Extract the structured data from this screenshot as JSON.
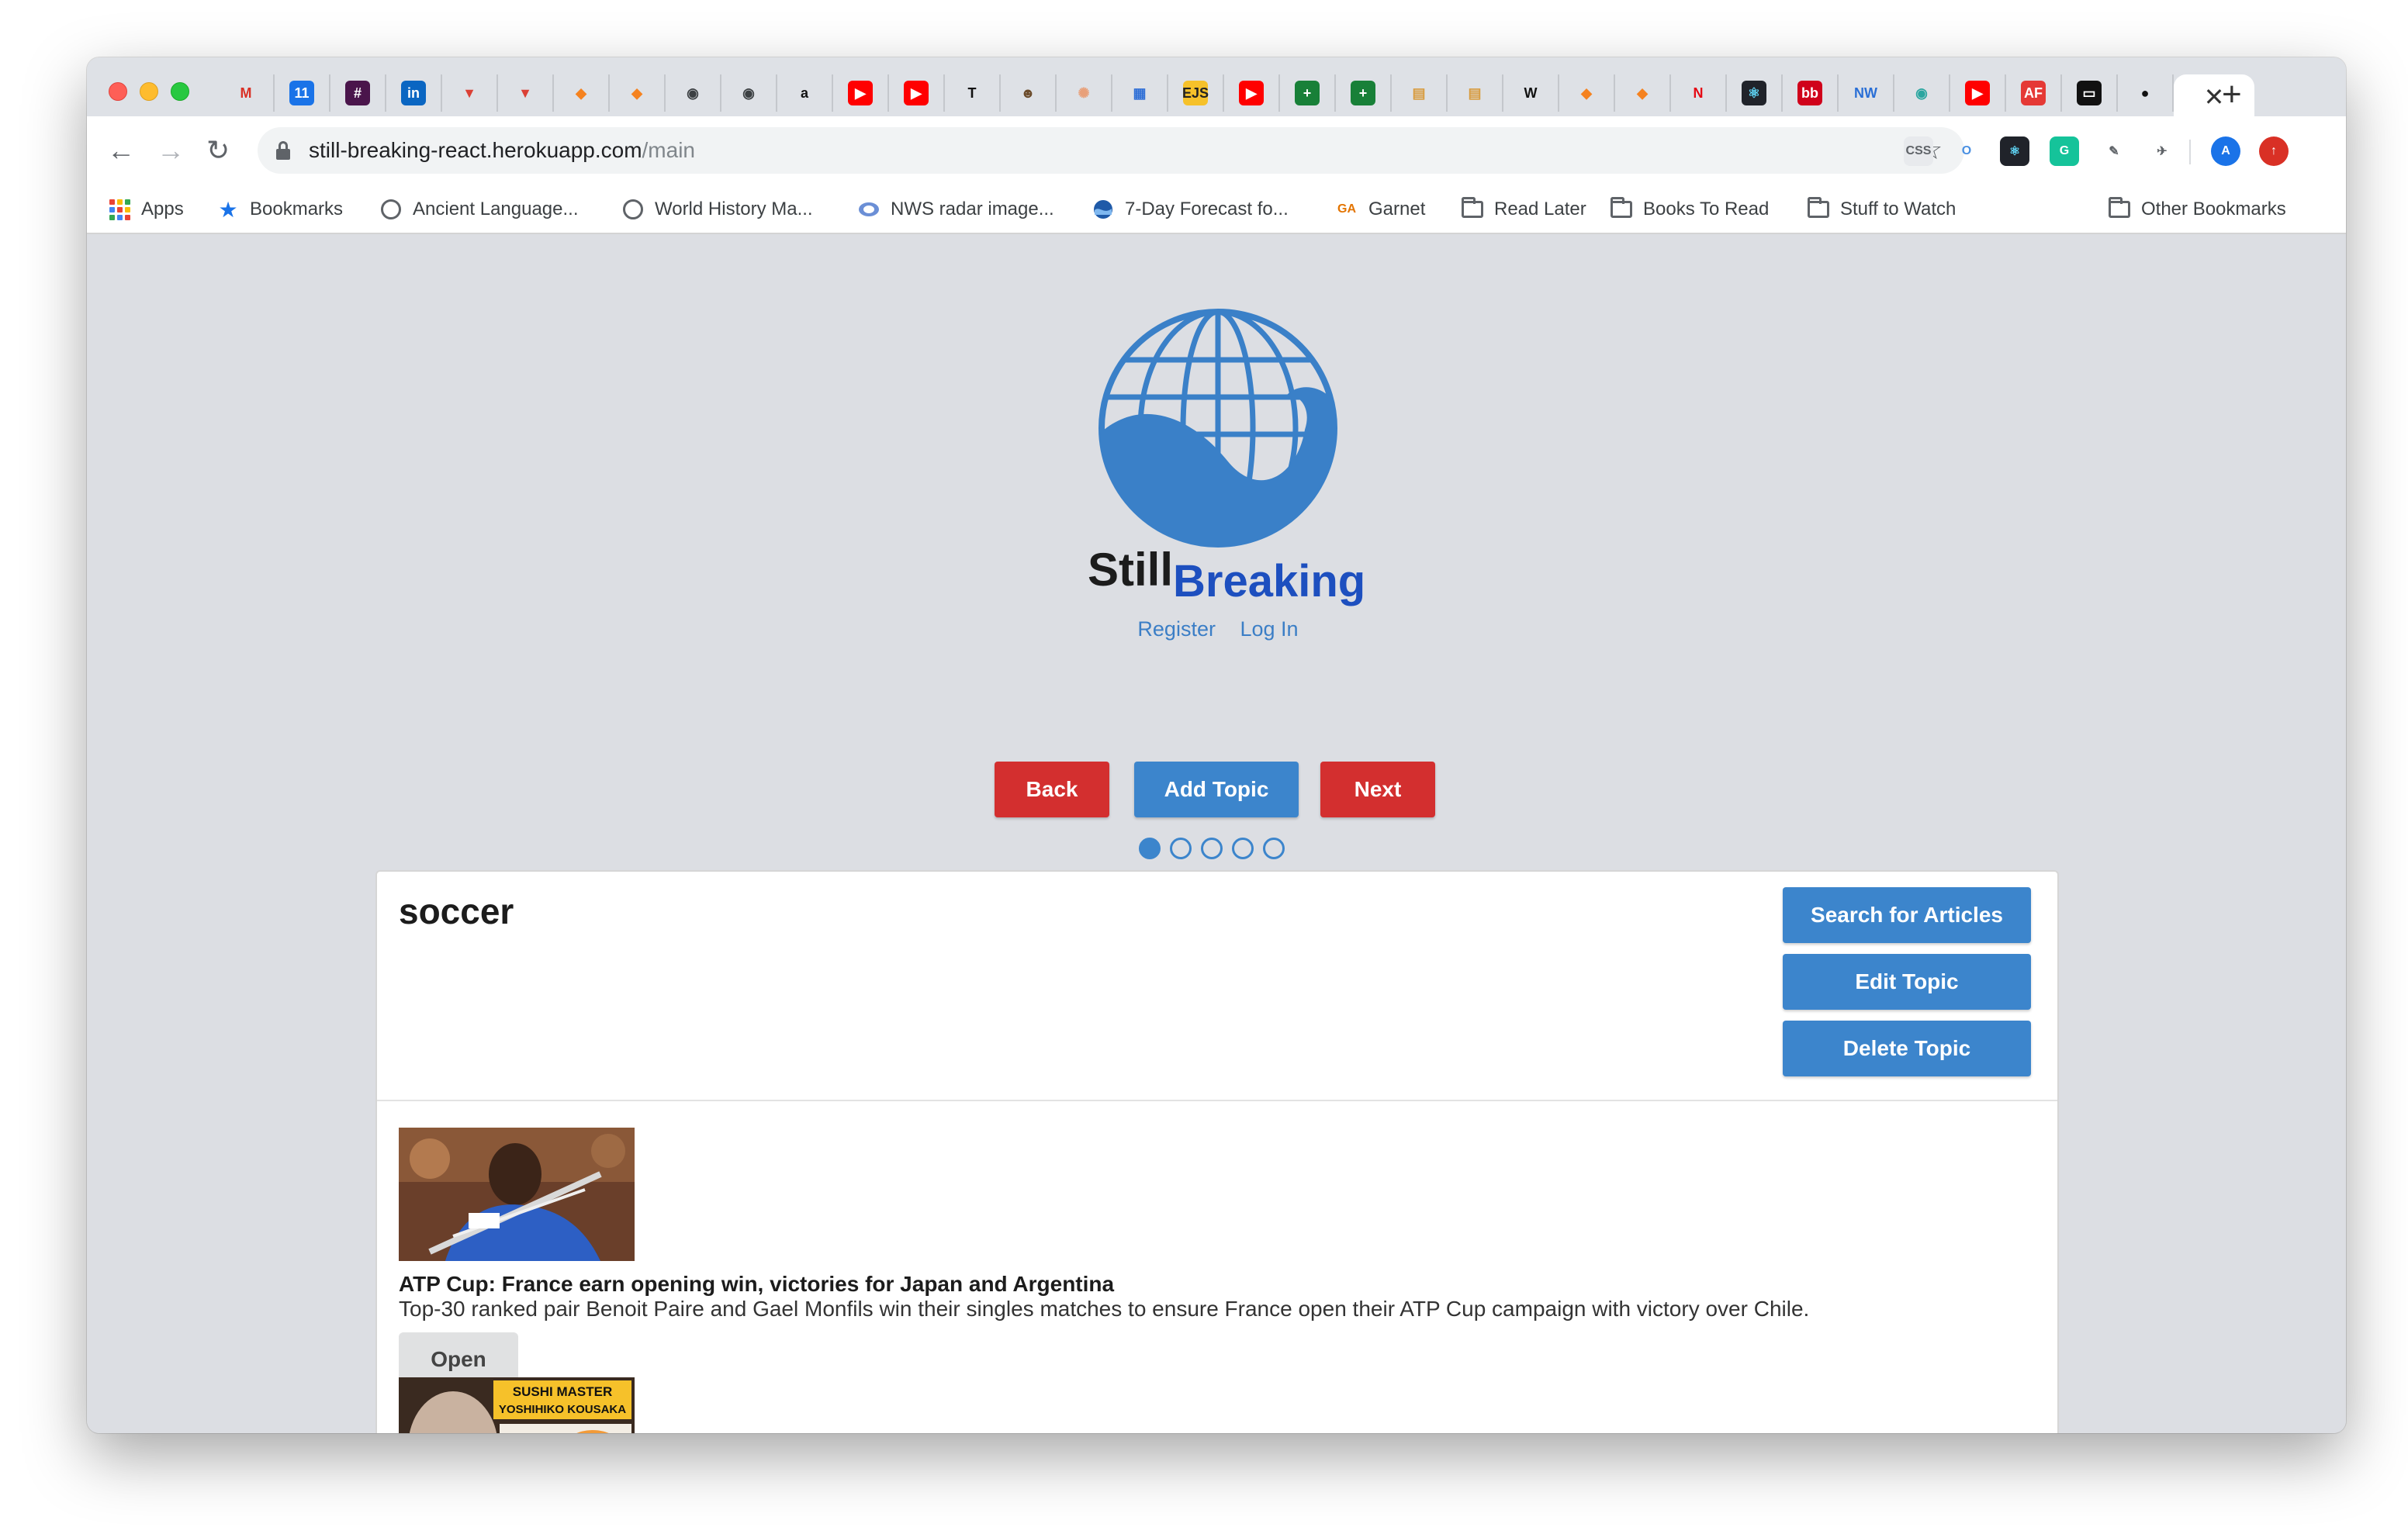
{
  "browser": {
    "active_tab_close": "✕",
    "new_tab": "+",
    "url_host": "still-breaking-react.herokuapp.com",
    "url_path": "/main",
    "tab_favicons": [
      {
        "icon": "gmail-icon",
        "glyph": "M",
        "color": "#d93025",
        "bg": "transparent"
      },
      {
        "icon": "calendar-icon",
        "glyph": "11",
        "color": "#ffffff",
        "bg": "#1a73e8"
      },
      {
        "icon": "slack-icon",
        "glyph": "#",
        "color": "#ffffff",
        "bg": "#4a154b"
      },
      {
        "icon": "linkedin-icon",
        "glyph": "in",
        "color": "#ffffff",
        "bg": "#0a66c2"
      },
      {
        "icon": "todoist-icon",
        "glyph": "▼",
        "color": "#db4035",
        "bg": "transparent"
      },
      {
        "icon": "todoist-icon",
        "glyph": "▼",
        "color": "#db4035",
        "bg": "transparent"
      },
      {
        "icon": "box-icon",
        "glyph": "◆",
        "color": "#f5821f",
        "bg": "transparent"
      },
      {
        "icon": "box-icon",
        "glyph": "◆",
        "color": "#f5821f",
        "bg": "transparent"
      },
      {
        "icon": "globe-icon",
        "glyph": "◉",
        "color": "#3c4043",
        "bg": "transparent"
      },
      {
        "icon": "globe-icon",
        "glyph": "◉",
        "color": "#3c4043",
        "bg": "transparent"
      },
      {
        "icon": "amazon-icon",
        "glyph": "a",
        "color": "#111111",
        "bg": "transparent"
      },
      {
        "icon": "youtube-icon",
        "glyph": "▶",
        "color": "#ffffff",
        "bg": "#ff0000"
      },
      {
        "icon": "youtube-icon",
        "glyph": "▶",
        "color": "#ffffff",
        "bg": "#ff0000"
      },
      {
        "icon": "nytimes-icon",
        "glyph": "T",
        "color": "#111111",
        "bg": "transparent"
      },
      {
        "icon": "meerkat-icon",
        "glyph": "☻",
        "color": "#6b4b2a",
        "bg": "transparent"
      },
      {
        "icon": "sparkle-icon",
        "glyph": "✺",
        "color": "#e8a07a",
        "bg": "transparent"
      },
      {
        "icon": "dashboard-icon",
        "glyph": "▦",
        "color": "#2f6fd6",
        "bg": "transparent"
      },
      {
        "icon": "ejs-icon",
        "glyph": "EJS",
        "color": "#222222",
        "bg": "#f6c12a"
      },
      {
        "icon": "youtube-icon",
        "glyph": "▶",
        "color": "#ffffff",
        "bg": "#ff0000"
      },
      {
        "icon": "sheets-icon",
        "glyph": "+",
        "color": "#ffffff",
        "bg": "#188038"
      },
      {
        "icon": "sheets-icon",
        "glyph": "+",
        "color": "#ffffff",
        "bg": "#188038"
      },
      {
        "icon": "book-icon",
        "glyph": "▤",
        "color": "#d89b3d",
        "bg": "transparent"
      },
      {
        "icon": "book-icon",
        "glyph": "▤",
        "color": "#d89b3d",
        "bg": "transparent"
      },
      {
        "icon": "wikipedia-icon",
        "glyph": "W",
        "color": "#111111",
        "bg": "transparent"
      },
      {
        "icon": "box-icon",
        "glyph": "◆",
        "color": "#f5821f",
        "bg": "transparent"
      },
      {
        "icon": "box-icon",
        "glyph": "◆",
        "color": "#f5821f",
        "bg": "transparent"
      },
      {
        "icon": "netflix-icon",
        "glyph": "N",
        "color": "#e50914",
        "bg": "transparent"
      },
      {
        "icon": "react-icon",
        "glyph": "⚛",
        "color": "#61dafb",
        "bg": "#20232a"
      },
      {
        "icon": "bb-icon",
        "glyph": "bb",
        "color": "#ffffff",
        "bg": "#d0021b"
      },
      {
        "icon": "nw-icon",
        "glyph": "NW",
        "color": "#2a6fd6",
        "bg": "transparent"
      },
      {
        "icon": "eye-icon",
        "glyph": "◉",
        "color": "#2aa6a0",
        "bg": "transparent"
      },
      {
        "icon": "youtube-icon",
        "glyph": "▶",
        "color": "#ffffff",
        "bg": "#ff0000"
      },
      {
        "icon": "af-icon",
        "glyph": "AF",
        "color": "#ffffff",
        "bg": "#e53935"
      },
      {
        "icon": "terminal-icon",
        "glyph": "▭",
        "color": "#ffffff",
        "bg": "#111111"
      },
      {
        "icon": "github-icon",
        "glyph": "●",
        "color": "#111111",
        "bg": "transparent"
      }
    ],
    "extensions": [
      {
        "icon": "css-icon",
        "glyph": "CSS",
        "color": "#5f6368",
        "bg": "#e8eaed"
      },
      {
        "icon": "opera-icon",
        "glyph": "O",
        "color": "#4a90e2",
        "bg": "transparent"
      },
      {
        "icon": "react-devtools-icon",
        "glyph": "⚛",
        "color": "#61dafb",
        "bg": "#20232a"
      },
      {
        "icon": "grammarly-icon",
        "glyph": "G",
        "color": "#ffffff",
        "bg": "#15c39a"
      },
      {
        "icon": "eyedropper-icon",
        "glyph": "✎",
        "color": "#5f6368",
        "bg": "transparent"
      },
      {
        "icon": "octotree-icon",
        "glyph": "✈",
        "color": "#5f6368",
        "bg": "transparent"
      },
      {
        "icon": "profile-avatar-icon",
        "glyph": "A",
        "color": "#ffffff",
        "bg": "#1a73e8"
      },
      {
        "icon": "update-icon",
        "glyph": "↑",
        "color": "#ffffff",
        "bg": "#d93025"
      }
    ],
    "extension_badge": "2"
  },
  "bookmarks": [
    {
      "label": "Apps",
      "icon": "apps-grid-icon"
    },
    {
      "label": "Bookmarks",
      "icon": "star-icon"
    },
    {
      "label": "Ancient Language...",
      "icon": "globe-icon"
    },
    {
      "label": "World History Ma...",
      "icon": "globe-icon"
    },
    {
      "label": "NWS radar image...",
      "icon": "nws-icon"
    },
    {
      "label": "7-Day Forecast fo...",
      "icon": "noaa-icon"
    },
    {
      "label": "Garnet",
      "icon": "ga-icon"
    },
    {
      "label": "Read Later",
      "icon": "folder-icon"
    },
    {
      "label": "Books To Read",
      "icon": "folder-icon"
    },
    {
      "label": "Stuff to Watch",
      "icon": "folder-icon"
    },
    {
      "label": "Other Bookmarks",
      "icon": "folder-icon"
    }
  ],
  "bookmark_ga_glyph": "GA",
  "app": {
    "brand_still": "Still",
    "brand_breaking": "Breaking",
    "register": "Register",
    "login": "Log In",
    "back": "Back",
    "add_topic": "Add Topic",
    "next": "Next",
    "carousel_total": 5,
    "carousel_active": 1,
    "colors": {
      "blue": "#3c85cc",
      "red": "#d32f2f",
      "brand_blue": "#1d4fbf"
    }
  },
  "topic": {
    "title": "soccer",
    "search_articles": "Search for Articles",
    "edit_topic": "Edit Topic",
    "delete_topic": "Delete Topic",
    "articles": [
      {
        "title": "ATP Cup: France earn opening win, victories for Japan and Argentina",
        "description": "Top-30 ranked pair Benoit Paire and Gael Monfils win their singles matches to ensure France open their ATP Cup campaign with victory over Chile.",
        "open": "Open"
      },
      {
        "thumb_caption_line1": "SUSHI MASTER",
        "thumb_caption_line2": "YOSHIHIKO KOUSAKA"
      }
    ]
  }
}
